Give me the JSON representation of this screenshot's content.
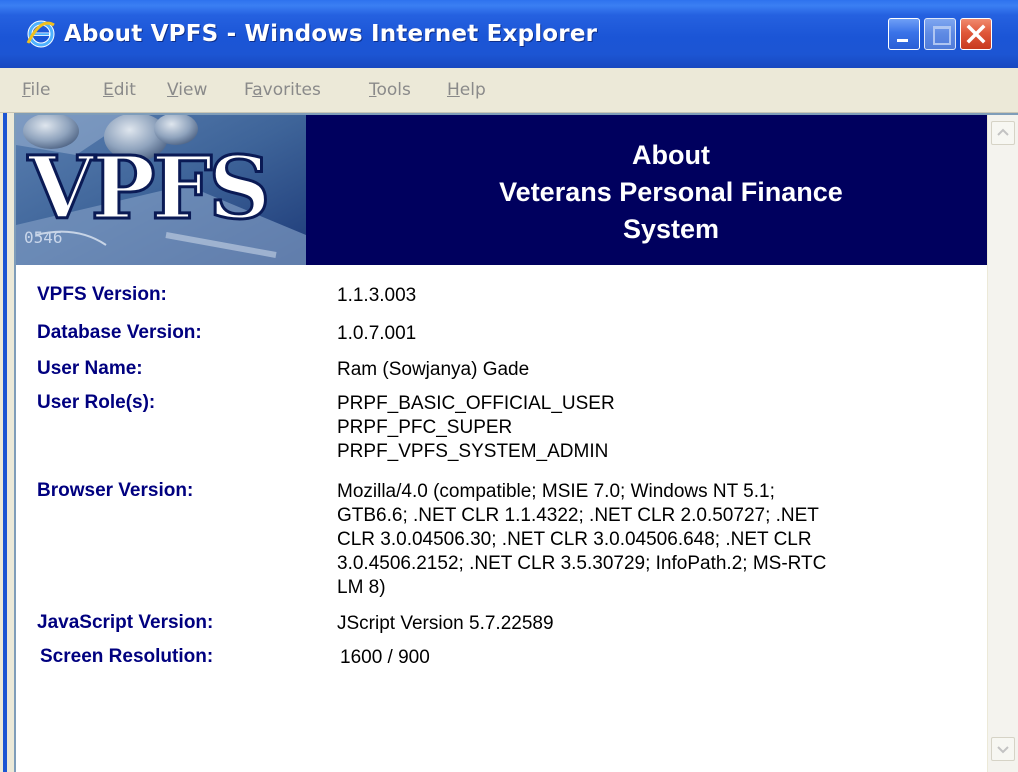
{
  "window": {
    "title": "About VPFS - Windows Internet Explorer"
  },
  "menu": [
    {
      "pre": "",
      "key": "F",
      "post": "ile"
    },
    {
      "pre": "",
      "key": "E",
      "post": "dit"
    },
    {
      "pre": "",
      "key": "V",
      "post": "iew"
    },
    {
      "pre": "F",
      "key": "a",
      "post": "vorites"
    },
    {
      "pre": "",
      "key": "T",
      "post": "ools"
    },
    {
      "pre": "",
      "key": "H",
      "post": "elp"
    }
  ],
  "header": {
    "logo_text": "VPFS",
    "title_line1": "About",
    "title_line2": "Veterans Personal Finance",
    "title_line3": "System"
  },
  "info": [
    {
      "label": "VPFS Version:",
      "lines": [
        "1.1.3.003"
      ]
    },
    {
      "label": "Database Version:",
      "lines": [
        "1.0.7.001"
      ]
    },
    {
      "label": "User Name:",
      "lines": [
        "Ram (Sowjanya) Gade"
      ]
    },
    {
      "label": "User Role(s):",
      "lines": [
        "PRPF_BASIC_OFFICIAL_USER",
        "PRPF_PFC_SUPER",
        "PRPF_VPFS_SYSTEM_ADMIN"
      ]
    },
    {
      "label": "Browser Version:",
      "lines": [
        "Mozilla/4.0 (compatible; MSIE 7.0; Windows NT 5.1;",
        "GTB6.6; .NET CLR 1.1.4322; .NET CLR 2.0.50727; .NET",
        "CLR 3.0.04506.30; .NET CLR 3.0.04506.648; .NET CLR",
        "3.0.4506.2152; .NET CLR 3.5.30729; InfoPath.2; MS-RTC",
        "LM 8)"
      ]
    },
    {
      "label": "JavaScript Version:",
      "lines": [
        "JScript Version 5.7.22589"
      ]
    },
    {
      "label": "Screen Resolution:",
      "lines": [
        "1600 / 900"
      ]
    }
  ],
  "colors": {
    "title_bar": "#1c55d3",
    "banner": "#00005e",
    "label": "#00007f"
  }
}
